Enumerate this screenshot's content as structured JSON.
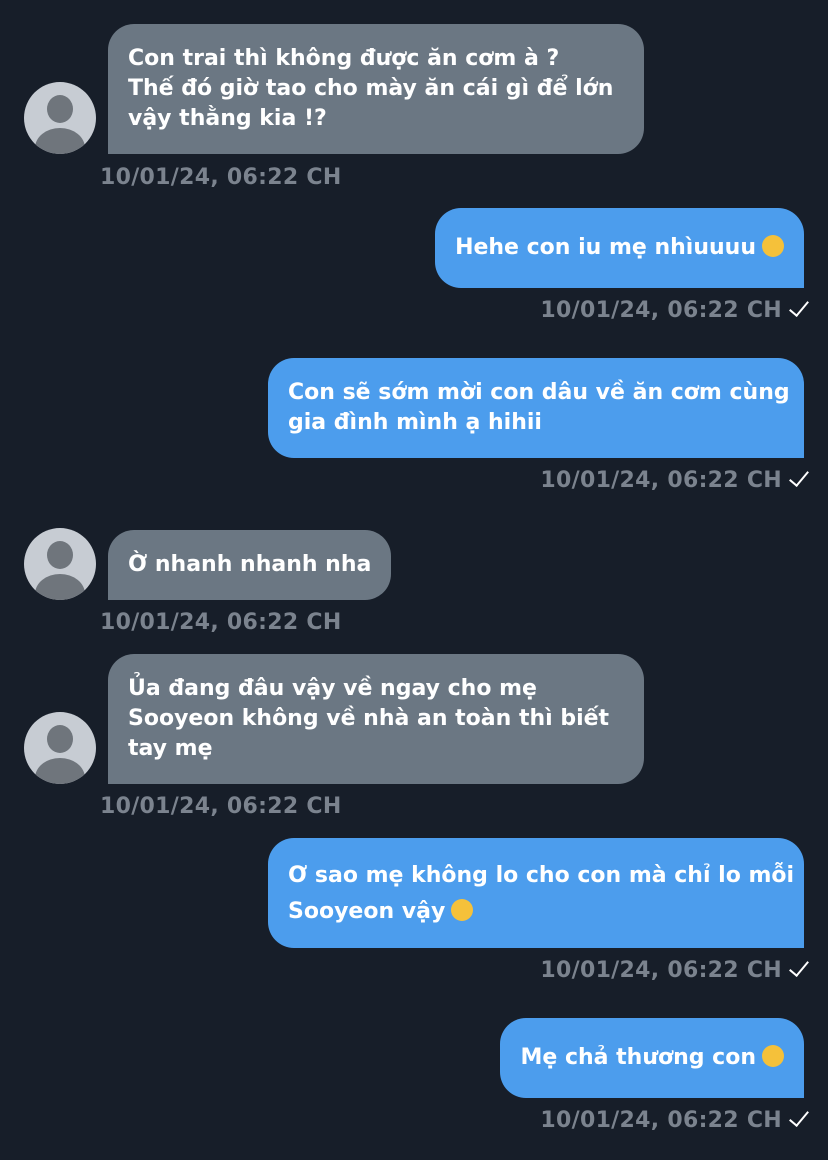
{
  "messages": [
    {
      "direction": "in",
      "lines": [
        "Con trai thì không được ăn cơm à ?",
        "Thế đó giờ tao cho mày ăn cái gì để lớn",
        "vậy thằng kia !?"
      ],
      "timestamp": "10/01/24, 06:22 CH"
    },
    {
      "direction": "out",
      "lines": [
        "Hehe con iu mẹ nhìuuuu"
      ],
      "emoji": "face-blowing-kiss-emoji",
      "timestamp": "10/01/24, 06:22 CH",
      "status": "sent"
    },
    {
      "direction": "out",
      "lines": [
        "Con sẽ sớm mời con dâu về ăn cơm cùng",
        "gia đình mình ạ hihii"
      ],
      "timestamp": "10/01/24, 06:22 CH",
      "status": "sent"
    },
    {
      "direction": "in",
      "lines": [
        "Ờ nhanh nhanh nha"
      ],
      "timestamp": "10/01/24, 06:22 CH"
    },
    {
      "direction": "in",
      "lines": [
        "Ủa đang đâu vậy về ngay cho mẹ",
        "Sooyeon không về nhà an toàn thì biết",
        "tay mẹ"
      ],
      "timestamp": "10/01/24, 06:22 CH"
    },
    {
      "direction": "out",
      "lines": [
        "Ơ sao mẹ không lo cho con mà chỉ lo mỗi",
        "Sooyeon vậy"
      ],
      "emoji": "loudly-crying-face-emoji",
      "timestamp": "10/01/24, 06:22 CH",
      "status": "sent"
    },
    {
      "direction": "out",
      "lines": [
        "Mẹ chả thương con"
      ],
      "emoji": "disappointed-face-emoji",
      "timestamp": "10/01/24, 06:22 CH",
      "status": "sent"
    }
  ],
  "colors": {
    "background": "#171e29",
    "incoming_bubble": "#6b7783",
    "outgoing_bubble": "#4c9ded",
    "timestamp": "#7b838e",
    "avatar": "#c7ccd3",
    "emoji": "#f5c13a"
  },
  "icons": {
    "avatar": "default-user-avatar",
    "read_status": "checkmark-icon"
  }
}
